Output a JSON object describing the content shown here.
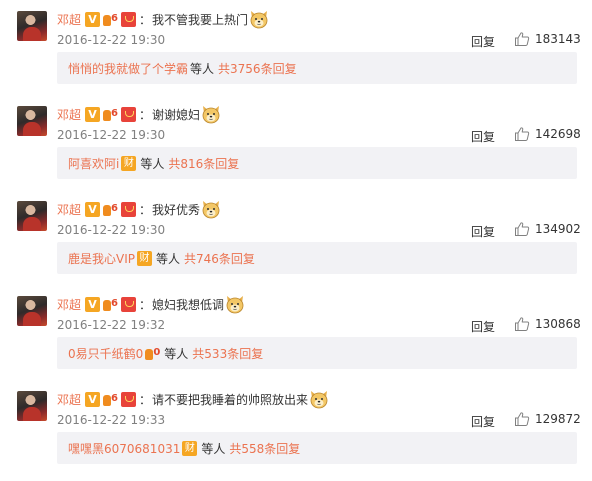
{
  "comments": [
    {
      "username": "邓超",
      "colon": "：",
      "text": "我不管我要上热门",
      "emoji": "doge-icon",
      "time": "2016-12-22 19:30",
      "reply_label": "回复",
      "likes": "183143",
      "replies": {
        "name": "悄悄的我就做了个学霸",
        "badge": "",
        "mid": "等人",
        "total": "共3756条回复"
      }
    },
    {
      "username": "邓超",
      "colon": "：",
      "text": "谢谢媳妇",
      "emoji": "doge-icon",
      "time": "2016-12-22 19:30",
      "reply_label": "回复",
      "likes": "142698",
      "replies": {
        "name": "阿喜欢阿i",
        "badge": "财",
        "mid": "等人",
        "total": "共816条回复"
      }
    },
    {
      "username": "邓超",
      "colon": "：",
      "text": "我好优秀",
      "emoji": "doge-icon",
      "time": "2016-12-22 19:30",
      "reply_label": "回复",
      "likes": "134902",
      "replies": {
        "name": "鹿是我心VIP",
        "badge": "财",
        "mid": "等人",
        "total": "共746条回复"
      }
    },
    {
      "username": "邓超",
      "colon": "：",
      "text": "媳妇我想低调",
      "emoji": "doge-icon",
      "time": "2016-12-22 19:32",
      "reply_label": "回复",
      "likes": "130868",
      "replies": {
        "name": "0易只千纸鹤0",
        "badge": "vip",
        "mid": "等人",
        "total": "共533条回复"
      }
    },
    {
      "username": "邓超",
      "colon": "：",
      "text": "请不要把我睡着的帅照放出来",
      "emoji": "doge-icon",
      "time": "2016-12-22 19:33",
      "reply_label": "回复",
      "likes": "129872",
      "replies": {
        "name": "嘿嘿黑6070681031",
        "badge": "财",
        "mid": "等人",
        "total": "共558条回复"
      }
    }
  ],
  "badges": {
    "verified": "V",
    "verified_icon": "verified-v-icon",
    "vip_icon": "vip-level-icon",
    "red_icon": "red-packet-icon"
  },
  "colors": {
    "username": "#eb7350",
    "reply_bg": "#f2f2f5",
    "time": "#808080",
    "verified": "#f5a623"
  }
}
